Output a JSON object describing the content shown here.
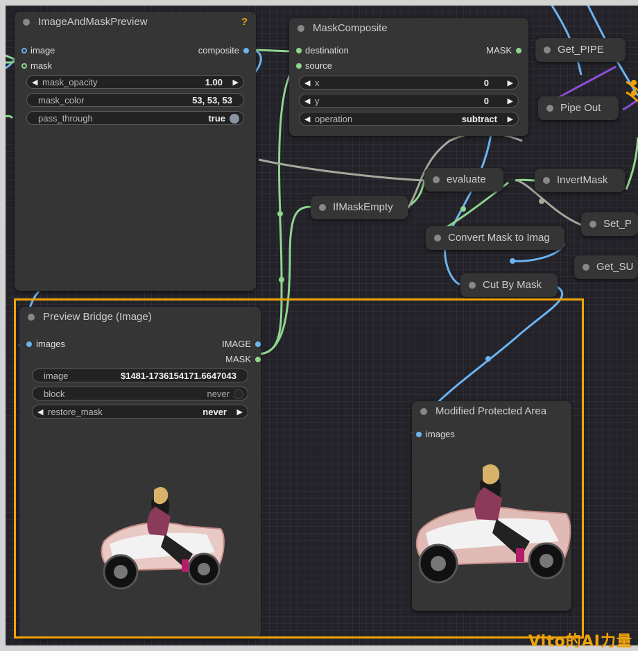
{
  "colors": {
    "canvas": "#232229",
    "node": "#353535",
    "wire_blue": "#6cb4f0",
    "wire_green": "#8ed68e",
    "wire_gray": "#a3a99a",
    "wire_purple": "#8a4fd6",
    "highlight": "#f0a30a"
  },
  "nodes": {
    "image_and_mask_preview": {
      "title": "ImageAndMaskPreview",
      "help": "?",
      "inputs": [
        "image",
        "mask"
      ],
      "output": "composite",
      "widgets": {
        "mask_opacity": {
          "label": "mask_opacity",
          "value": "1.00"
        },
        "mask_color": {
          "label": "mask_color",
          "value": "53, 53, 53"
        },
        "pass_through": {
          "label": "pass_through",
          "value": "true"
        }
      }
    },
    "mask_composite": {
      "title": "MaskComposite",
      "inputs": [
        "destination",
        "source"
      ],
      "output": "MASK",
      "widgets": {
        "x": {
          "label": "x",
          "value": "0"
        },
        "y": {
          "label": "y",
          "value": "0"
        },
        "operation": {
          "label": "operation",
          "value": "subtract"
        }
      }
    },
    "get_pipe": {
      "title": "Get_PIPE"
    },
    "pipe_out": {
      "title": "Pipe Out"
    },
    "evaluate": {
      "title": "evaluate"
    },
    "invert_mask": {
      "title": "InvertMask"
    },
    "set_p": {
      "title": "Set_P"
    },
    "if_mask_empty": {
      "title": "IfMaskEmpty"
    },
    "convert_mask": {
      "title": "Convert Mask to Imag"
    },
    "get_su": {
      "title": "Get_SU"
    },
    "cut_by_mask": {
      "title": "Cut By Mask"
    },
    "preview_bridge": {
      "title": "Preview Bridge (Image)",
      "input": "images",
      "outputs": [
        "IMAGE",
        "MASK"
      ],
      "widgets": {
        "image": {
          "label": "image",
          "value": "$1481-1736154171.6647043"
        },
        "block": {
          "label": "block",
          "value": "never"
        },
        "restore_mask": {
          "label": "restore_mask",
          "value": "never"
        }
      }
    },
    "modified_protected_area": {
      "title": "Modified Protected Area",
      "input": "images"
    }
  },
  "watermark": "Vito的AI力量"
}
